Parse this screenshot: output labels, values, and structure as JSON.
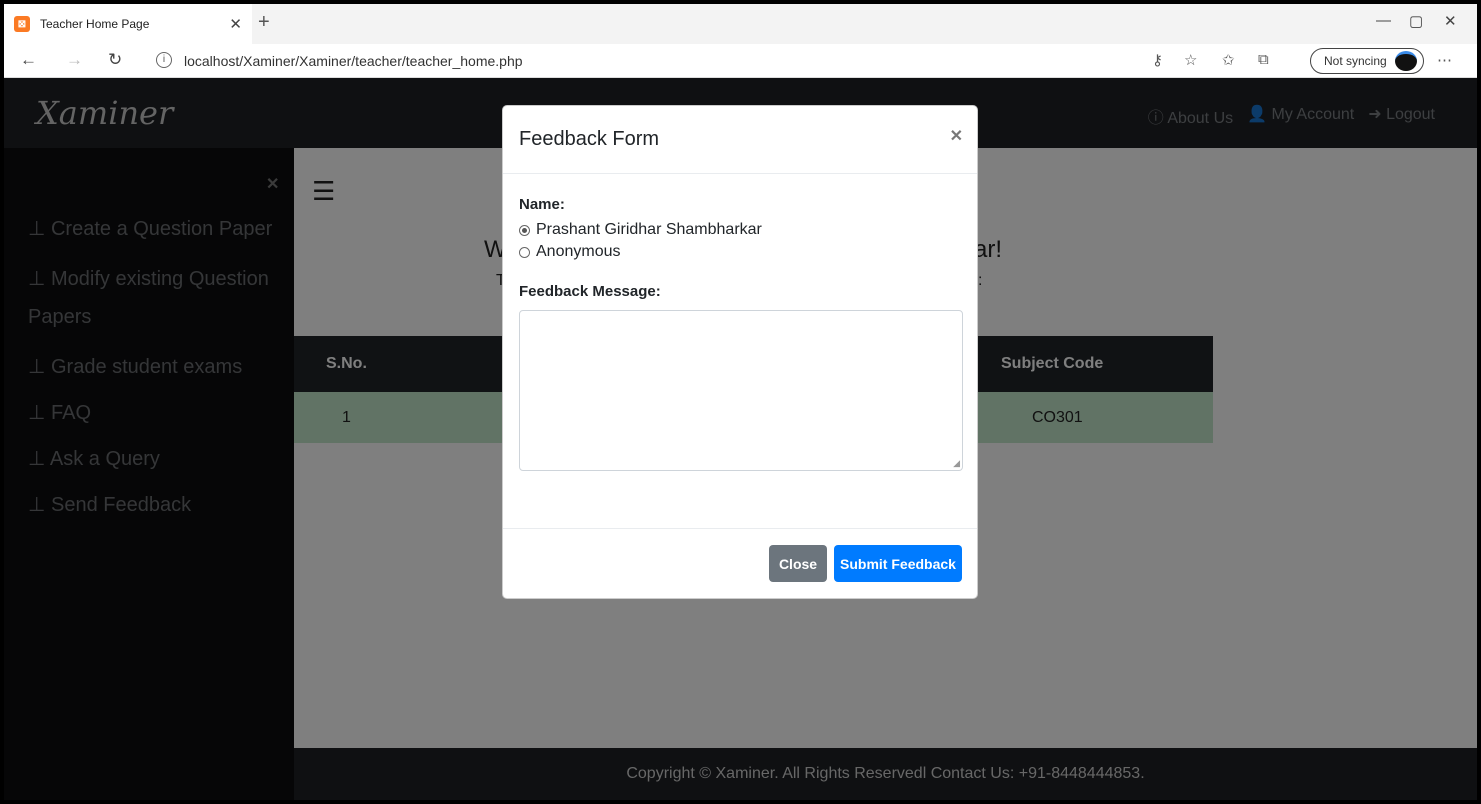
{
  "browser": {
    "tab_title": "Teacher Home Page",
    "url": "localhost/Xaminer/Xaminer/teacher/teacher_home.php",
    "sync_label": "Not syncing"
  },
  "navbar": {
    "brand": "Xaminer",
    "links": [
      "About Us",
      "My Account",
      "Logout"
    ]
  },
  "sidebar": {
    "items": [
      "Create a Question Paper",
      "Modify existing Question Papers",
      "Grade student exams",
      "FAQ",
      "Ask a Query",
      "Send Feedback"
    ]
  },
  "main": {
    "welcome_left": "W",
    "welcome_right": "ar!",
    "sub_left": "T",
    "sub_right": ":",
    "table": {
      "headers": [
        "S.No.",
        "Subject Code"
      ],
      "rows": [
        [
          "1",
          "CO301"
        ]
      ]
    }
  },
  "footer": {
    "text": "Copyright © Xaminer. All Rights Reservedl Contact Us: +91-8448444853."
  },
  "modal": {
    "title": "Feedback Form",
    "name_label": "Name:",
    "options": [
      "Prashant Giridhar Shambharkar",
      "Anonymous"
    ],
    "selected_option": "Prashant Giridhar Shambharkar",
    "message_label": "Feedback Message:",
    "message_value": "",
    "close_label": "Close",
    "submit_label": "Submit Feedback"
  },
  "colors": {
    "primary": "#007bff",
    "secondary": "#6c757d",
    "navbar": "#1e2125",
    "row_success": "#c3e6cb"
  }
}
